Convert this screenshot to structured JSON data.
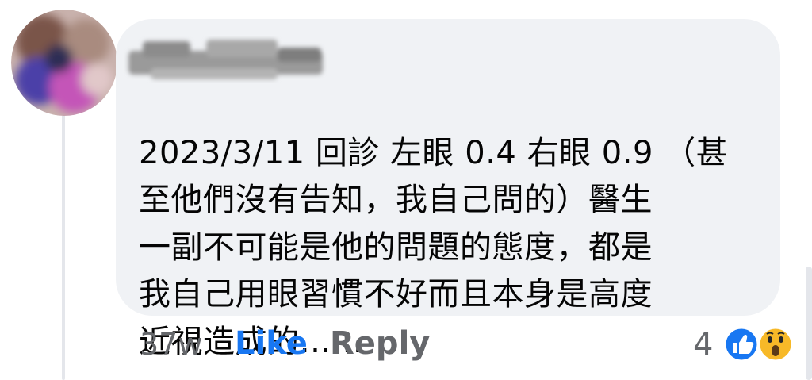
{
  "comment": {
    "lines": [
      "2023/3/11 回診 左眼 0.4 右眼 0.9 （甚",
      "至他們沒有告知，我自己問的）醫生",
      "一副不可能是他的問題的態度，都是",
      "我自己用眼習慣不好而且本身是高度",
      "近視造成的……"
    ]
  },
  "actions": {
    "timestamp": "37w",
    "like_label": "Like",
    "reply_label": "Reply"
  },
  "reactions": {
    "count": "4",
    "icons": [
      "like-reaction-icon",
      "wow-reaction-icon"
    ]
  },
  "colors": {
    "bubble": "#f0f2f5",
    "like_blue": "#1877f2",
    "secondary_text": "#65676b",
    "wow_yellow": "#f7b928"
  }
}
